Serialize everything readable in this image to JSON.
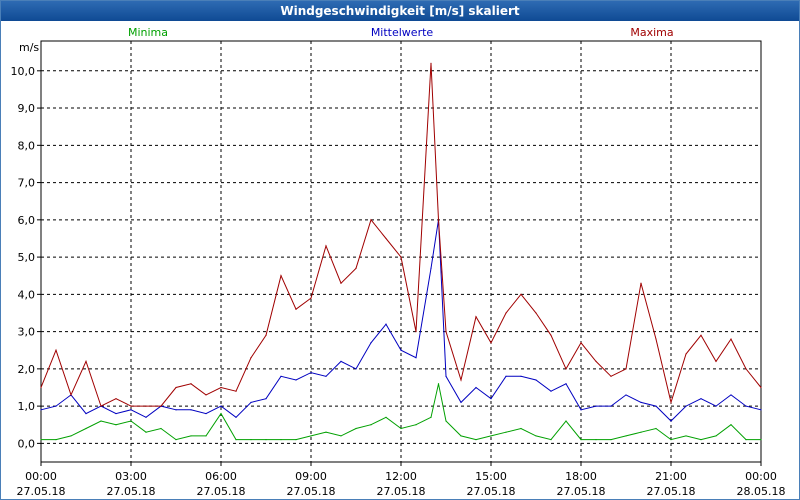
{
  "window": {
    "title": "Windgeschwindigkeit [m/s] skaliert"
  },
  "chart_data": {
    "type": "line",
    "title": "Windgeschwindigkeit [m/s] skaliert",
    "ylabel": "m/s",
    "ylim": [
      -0.5,
      10.8
    ],
    "xlim": [
      0,
      24
    ],
    "grid": true,
    "legend_position": "top",
    "y_ticks": [
      "0,0",
      "1,0",
      "2,0",
      "3,0",
      "4,0",
      "5,0",
      "6,0",
      "7,0",
      "8,0",
      "9,0",
      "10,0"
    ],
    "x_ticks": [
      {
        "time": "00:00",
        "date": "27.05.18"
      },
      {
        "time": "03:00",
        "date": "27.05.18"
      },
      {
        "time": "06:00",
        "date": "27.05.18"
      },
      {
        "time": "09:00",
        "date": "27.05.18"
      },
      {
        "time": "12:00",
        "date": "27.05.18"
      },
      {
        "time": "15:00",
        "date": "27.05.18"
      },
      {
        "time": "18:00",
        "date": "27.05.18"
      },
      {
        "time": "21:00",
        "date": "27.05.18"
      },
      {
        "time": "00:00",
        "date": "28.05.18"
      }
    ],
    "series": [
      {
        "name": "Minima",
        "color": "#00a000",
        "x": [
          0,
          0.5,
          1,
          1.5,
          2,
          2.5,
          3,
          3.5,
          4,
          4.5,
          5,
          5.5,
          6,
          6.5,
          7,
          7.5,
          8,
          8.5,
          9,
          9.5,
          10,
          10.5,
          11,
          11.5,
          12,
          12.5,
          13,
          13.25,
          13.5,
          14,
          14.5,
          15,
          15.5,
          16,
          16.5,
          17,
          17.5,
          18,
          18.5,
          19,
          19.5,
          20,
          20.5,
          21,
          21.5,
          22,
          22.5,
          23,
          23.5,
          24
        ],
        "y": [
          0.1,
          0.1,
          0.2,
          0.4,
          0.6,
          0.5,
          0.6,
          0.3,
          0.4,
          0.1,
          0.2,
          0.2,
          0.8,
          0.1,
          0.1,
          0.1,
          0.1,
          0.1,
          0.2,
          0.3,
          0.2,
          0.4,
          0.5,
          0.7,
          0.4,
          0.5,
          0.7,
          1.6,
          0.6,
          0.2,
          0.1,
          0.2,
          0.3,
          0.4,
          0.2,
          0.1,
          0.6,
          0.1,
          0.1,
          0.1,
          0.2,
          0.3,
          0.4,
          0.1,
          0.2,
          0.1,
          0.2,
          0.5,
          0.1,
          0.1
        ]
      },
      {
        "name": "Mittelwerte",
        "color": "#0000c0",
        "x": [
          0,
          0.5,
          1,
          1.5,
          2,
          2.5,
          3,
          3.5,
          4,
          4.5,
          5,
          5.5,
          6,
          6.5,
          7,
          7.5,
          8,
          8.5,
          9,
          9.5,
          10,
          10.5,
          11,
          11.5,
          12,
          12.5,
          13,
          13.25,
          13.5,
          14,
          14.5,
          15,
          15.5,
          16,
          16.5,
          17,
          17.5,
          18,
          18.5,
          19,
          19.5,
          20,
          20.5,
          21,
          21.5,
          22,
          22.5,
          23,
          23.5,
          24
        ],
        "y": [
          0.9,
          1.0,
          1.3,
          0.8,
          1.0,
          0.8,
          0.9,
          0.7,
          1.0,
          0.9,
          0.9,
          0.8,
          1.0,
          0.7,
          1.1,
          1.2,
          1.8,
          1.7,
          1.9,
          1.8,
          2.2,
          2.0,
          2.7,
          3.2,
          2.5,
          2.3,
          4.7,
          6.0,
          1.8,
          1.1,
          1.5,
          1.2,
          1.8,
          1.8,
          1.7,
          1.4,
          1.6,
          0.9,
          1.0,
          1.0,
          1.3,
          1.1,
          1.0,
          0.6,
          1.0,
          1.2,
          1.0,
          1.3,
          1.0,
          0.9
        ]
      },
      {
        "name": "Maxima",
        "color": "#a00000",
        "x": [
          0,
          0.5,
          1,
          1.5,
          2,
          2.5,
          3,
          3.5,
          4,
          4.5,
          5,
          5.5,
          6,
          6.5,
          7,
          7.5,
          8,
          8.5,
          9,
          9.5,
          10,
          10.5,
          11,
          11.5,
          12,
          12.5,
          13,
          13.25,
          13.5,
          14,
          14.5,
          15,
          15.5,
          16,
          16.5,
          17,
          17.5,
          18,
          18.5,
          19,
          19.5,
          20,
          20.5,
          21,
          21.5,
          22,
          22.5,
          23,
          23.5,
          24
        ],
        "y": [
          1.5,
          2.5,
          1.3,
          2.2,
          1.0,
          1.2,
          1.0,
          1.0,
          1.0,
          1.5,
          1.6,
          1.3,
          1.5,
          1.4,
          2.3,
          2.9,
          4.5,
          3.6,
          3.9,
          5.3,
          4.3,
          4.7,
          6.0,
          5.5,
          5.0,
          3.0,
          10.2,
          6.0,
          3.0,
          1.7,
          3.4,
          2.7,
          3.5,
          4.0,
          3.5,
          2.9,
          2.0,
          2.7,
          2.2,
          1.8,
          2.0,
          4.3,
          2.8,
          1.1,
          2.4,
          2.9,
          2.2,
          2.8,
          2.0,
          1.5
        ]
      }
    ]
  }
}
